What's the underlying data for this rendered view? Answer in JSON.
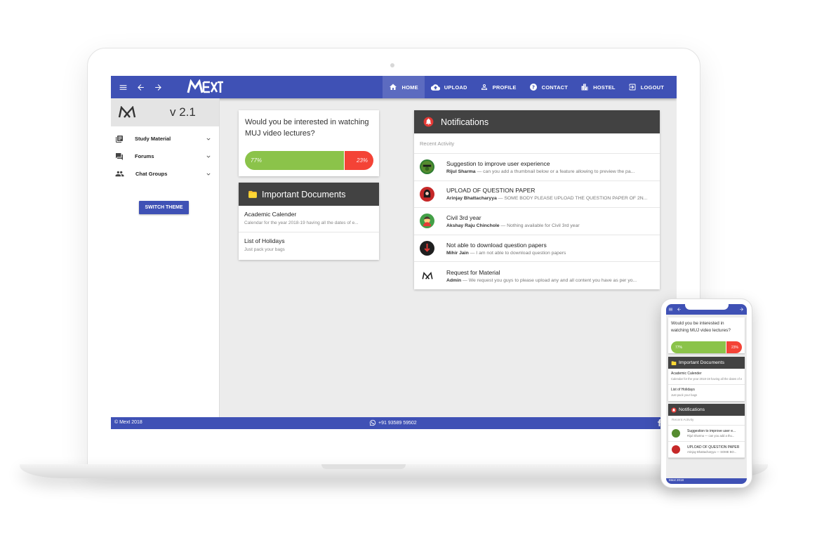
{
  "app": {
    "logo_text": "MEXT",
    "version": "v 2.1",
    "accent_color": "#3f51b5",
    "header_color": "#424242"
  },
  "nav": {
    "items": [
      {
        "label": "HOME",
        "icon": "home-icon",
        "active": true
      },
      {
        "label": "UPLOAD",
        "icon": "cloud-upload-icon",
        "active": false
      },
      {
        "label": "PROFILE",
        "icon": "person-icon",
        "active": false
      },
      {
        "label": "CONTACT",
        "icon": "help-icon",
        "active": false
      },
      {
        "label": "HOSTEL",
        "icon": "building-icon",
        "active": false
      },
      {
        "label": "LOGOUT",
        "icon": "logout-icon",
        "active": false
      }
    ]
  },
  "sidebar": {
    "items": [
      {
        "label": "Study Material",
        "icon": "library-icon"
      },
      {
        "label": "Forums",
        "icon": "forum-icon"
      },
      {
        "label": "Chat Groups",
        "icon": "group-icon"
      }
    ],
    "switch_theme": "SWITCH THEME"
  },
  "poll": {
    "question": "Would you be interested in watching MUJ video lectures?",
    "yes_label": "77%",
    "no_label": "23%",
    "yes_fraction": 0.77,
    "yes_color": "#8bc34a",
    "no_color": "#f44336"
  },
  "documents": {
    "title": "Important Documents",
    "items": [
      {
        "title": "Academic Calender",
        "subtitle": "Calendar for the year 2018-19 having all the dates of e..."
      },
      {
        "title": "List of Holidays",
        "subtitle": "Just pack your bags"
      }
    ]
  },
  "notifications": {
    "title": "Notifications",
    "section_label": "Recent Activity",
    "items": [
      {
        "title": "Suggestion to improve user experience",
        "author": "Rijul Sharma",
        "text": " — can you add a thumbnail below or a feature allowing to preview the pa...",
        "avatar_color": "#2e7d32"
      },
      {
        "title": "UPLOAD OF QUESTION PAPER",
        "author": "Arinjay Bhattacharyya",
        "text": " — SOME BODY PLEASE UPLOAD THE QUESTION PAPER OF 2N...",
        "avatar_color": "#c62828"
      },
      {
        "title": "Civil 3rd year",
        "author": "Akshay Raju Chinchole",
        "text": " — Nothing available for Civil 3rd year",
        "avatar_color": "#43a047"
      },
      {
        "title": "Not able to download question papers",
        "author": "Mihir Jain",
        "text": " — I am not able to download question papers",
        "avatar_color": "#b71c1c"
      },
      {
        "title": "Request for Material",
        "author": "Admin",
        "text": " — We request you guys to please upload any and all content you have as per yo...",
        "avatar_color": "#ffffff"
      }
    ]
  },
  "footer": {
    "copyright": "© Mext 2018",
    "phone": "+91 93589 59502"
  },
  "mobile": {
    "question": "Would you be interested in watching MUJ video lectures?",
    "yes_label": "77%",
    "no_label": "23%",
    "documents_title": "Important Documents",
    "docs": [
      {
        "title": "Academic Calender",
        "subtitle": "Calendar for the year 2018-19 having all the dates of e..."
      },
      {
        "title": "List of Holidays",
        "subtitle": "Just pack your bags"
      }
    ],
    "notifications_title": "Notifications",
    "section_label": "Recent Activity",
    "notifs": [
      {
        "title": "Suggestion to improve user e...",
        "line": "Rijul Sharma — can you add a thu..."
      },
      {
        "title": "UPLOAD OF QUESTION PAPER",
        "line": "Arinjay Bhattacharyya — SOME BO..."
      }
    ],
    "footer_text": "Mext 2018"
  }
}
